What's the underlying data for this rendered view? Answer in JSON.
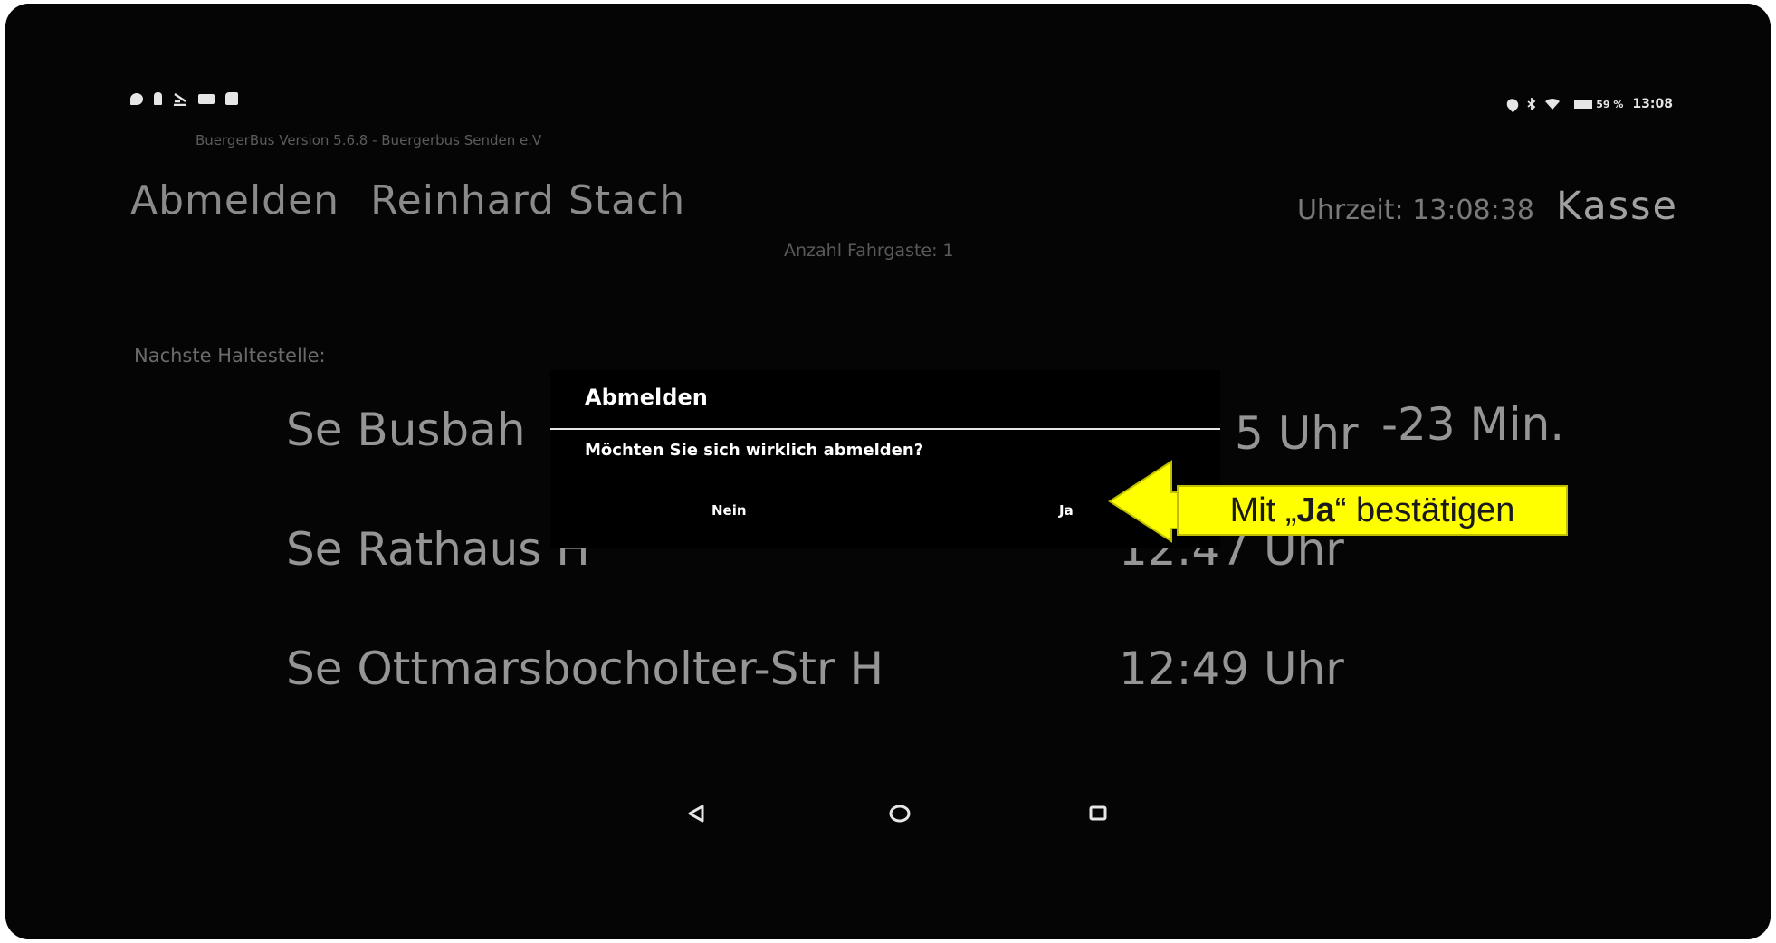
{
  "status_bar": {
    "battery": "59 %",
    "time": "13:08"
  },
  "app": {
    "version": "BuergerBus Version 5.6.8 - Buergerbus Senden e.V"
  },
  "header": {
    "logout_label": "Abmelden",
    "user_name": "Reinhard Stach",
    "clock_label": "Uhrzeit: 13:08:38",
    "kasse_label": "Kasse"
  },
  "passengers": "Anzahl Fahrgaste: 1",
  "next_stop_label": "Nachste Haltestelle:",
  "stops": [
    {
      "name": "Se Busbah",
      "time": "5 Uhr",
      "delay": "-23 Min."
    },
    {
      "name": "Se Rathaus H",
      "time": "12:47 Uhr"
    },
    {
      "name": "Se Ottmarsbocholter-Str H",
      "time": "12:49 Uhr"
    }
  ],
  "dialog": {
    "title": "Abmelden",
    "message": "Möchten Sie sich wirklich abmelden?",
    "no_label": "Nein",
    "yes_label": "Ja"
  },
  "annotation": {
    "prefix": "Mit „",
    "bold": "Ja",
    "suffix": "“ bestätigen",
    "color": "#ffff00"
  },
  "icons": {
    "status_left": [
      "chat-icon",
      "person-icon",
      "download-icon",
      "keyboard-icon",
      "sd-card-icon"
    ],
    "status_right": [
      "location-icon",
      "bluetooth-icon",
      "wifi-icon",
      "battery-icon"
    ],
    "navigation": [
      "back-icon",
      "home-icon",
      "recents-icon"
    ]
  }
}
